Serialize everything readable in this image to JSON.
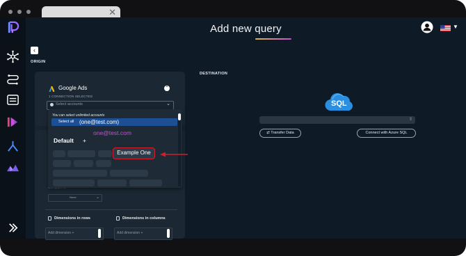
{
  "browser": {
    "tab_close": "✕"
  },
  "page": {
    "title": "Add new query",
    "back_glyph": "‹"
  },
  "sidebar": {
    "items": [
      {
        "name": "logo"
      },
      {
        "name": "connections-icon"
      },
      {
        "name": "transfers-icon"
      },
      {
        "name": "reports-icon"
      },
      {
        "name": "media-icon"
      },
      {
        "name": "branch-icon"
      },
      {
        "name": "analytics-icon"
      },
      {
        "name": "expand-icon"
      }
    ]
  },
  "origin": {
    "label": "ORIGIN",
    "source_name": "Google Ads",
    "connection_count": "1 CONNECTION SELECTED",
    "account_select": {
      "placeholder": "Select accounts"
    },
    "dropdown": {
      "note": "You can select unlimited accounts",
      "select_all": "Select all",
      "select_all_email": "(one@test.com)",
      "email": "one@test.com",
      "group": "Default",
      "group_plus": "+",
      "highlighted_account": "Example One"
    },
    "compare": {
      "label": "Compare to",
      "value": "None"
    },
    "dimensions_rows": {
      "label": "Dimensions in rows",
      "button": "Add dimension +"
    },
    "dimensions_columns": {
      "label": "Dimensions in columns",
      "button": "Add dimension +"
    }
  },
  "destination": {
    "label": "DESTINATION",
    "logo_text": "SQL",
    "transfer_button": "⇄ Transfer Data",
    "connect_button": "Connect with Azure SQL"
  },
  "colors": {
    "accent_blue": "#1c4f93",
    "highlight_red": "#d11f2d",
    "email_magenta": "#c84fd0"
  }
}
